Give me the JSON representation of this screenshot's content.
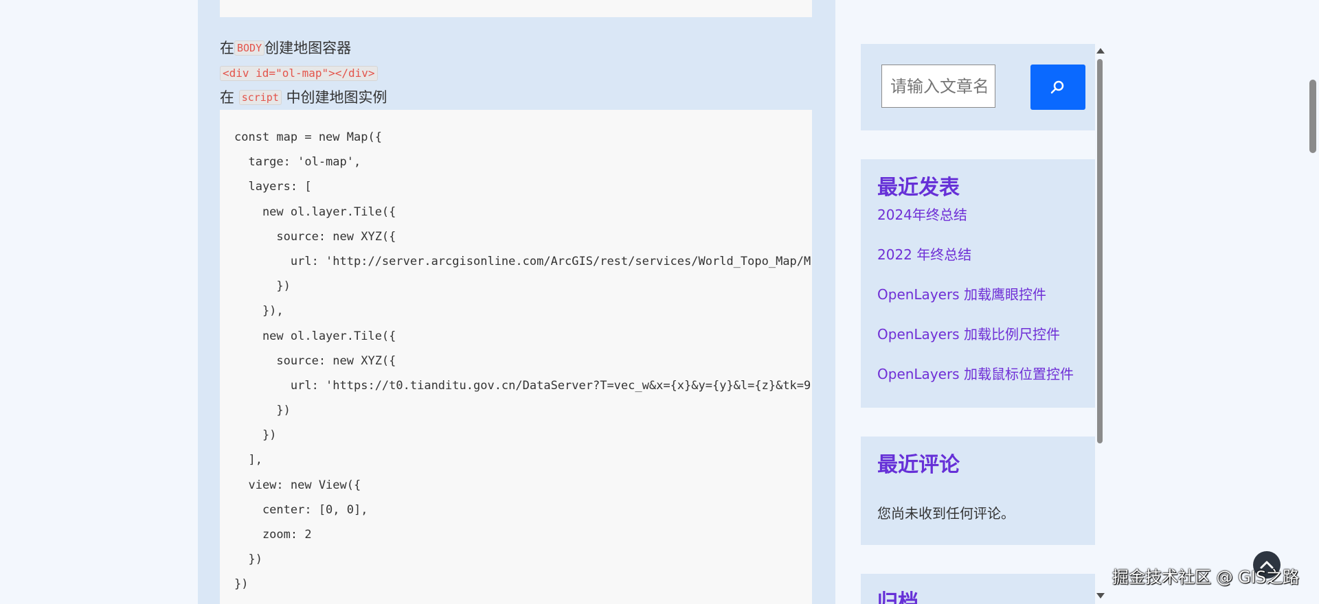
{
  "article": {
    "para1": {
      "prefix": "在",
      "code": "BODY",
      "suffix": "创建地图容器"
    },
    "code_inline": "<div id=\"ol-map\"></div>",
    "para3": {
      "prefix": "在",
      "code": "script",
      "suffix": "中创建地图实例"
    },
    "code_lines": [
      "const map = new Map({",
      "  targe: 'ol-map',",
      "  layers: [",
      "    new ol.layer.Tile({",
      "      source: new XYZ({",
      "        url: 'http://server.arcgisonline.com/ArcGIS/rest/services/World_Topo_Map/M",
      "      })",
      "    }),",
      "    new ol.layer.Tile({",
      "      source: new XYZ({",
      "        url: 'https://t0.tianditu.gov.cn/DataServer?T=vec_w&x={x}&y={y}&l={z}&tk=9",
      "      })",
      "    })",
      "  ],",
      "  view: new View({",
      "    center: [0, 0],",
      "    zoom: 2",
      "  })",
      "})"
    ]
  },
  "sidebar": {
    "search": {
      "placeholder": "请输入文章名称"
    },
    "recent_posts": {
      "title": "最近发表",
      "items": [
        "2024年终总结",
        "2022 年终总结",
        "OpenLayers 加载鹰眼控件",
        "OpenLayers 加载比例尺控件",
        "OpenLayers 加载鼠标位置控件"
      ]
    },
    "recent_comments": {
      "title": "最近评论",
      "empty_text": "您尚未收到任何评论。"
    },
    "archive": {
      "title": "归档"
    }
  },
  "watermark": "掘金技术社区 @ GIS之路",
  "icons": {
    "search_button": "search-icon",
    "back_to_top": "chevron-up-icon"
  },
  "colors": {
    "accent_purple": "#6630d7",
    "search_blue": "#0a69ff",
    "panel_bg": "#dae7f6",
    "page_bg": "#f3f7fd",
    "inline_code": "#e3544b"
  }
}
